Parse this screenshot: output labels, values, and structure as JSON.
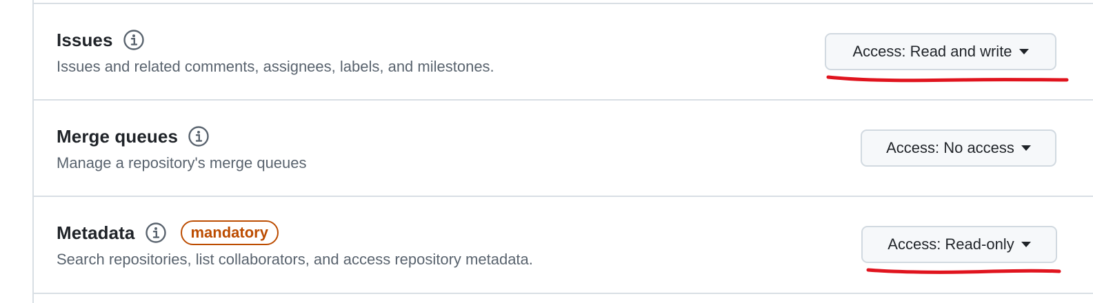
{
  "permissions": [
    {
      "title": "Issues",
      "description": "Issues and related comments, assignees, labels, and milestones.",
      "access_label": "Access: Read and write",
      "badge": ""
    },
    {
      "title": "Merge queues",
      "description": "Manage a repository's merge queues",
      "access_label": "Access: No access",
      "badge": ""
    },
    {
      "title": "Metadata",
      "description": "Search repositories, list collaborators, and access repository metadata.",
      "access_label": "Access: Read-only",
      "badge": "mandatory"
    }
  ],
  "icons": {
    "info": "info-icon",
    "caret": "triangle-down-icon"
  },
  "colors": {
    "badge": "#bc4c00",
    "annotation": "#e0141e",
    "border": "#d8dee4",
    "button_bg": "#f6f8fa"
  }
}
